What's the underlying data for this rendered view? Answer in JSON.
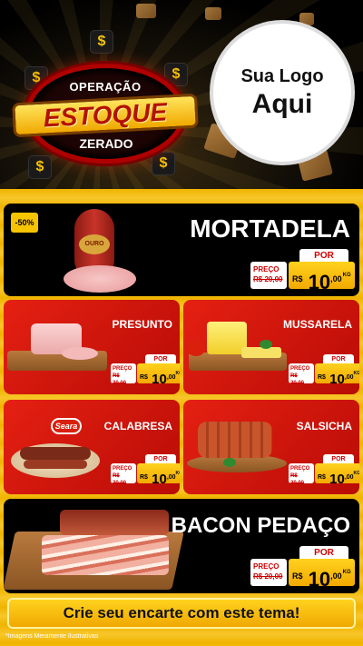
{
  "header": {
    "badge_top": "OPERAÇÃO",
    "badge_main": "ESTOQUE",
    "badge_bottom": "ZERADO",
    "logo_line1": "Sua Logo",
    "logo_line2": "Aqui"
  },
  "colors": {
    "accent_yellow": "#f7c400",
    "card_red": "#d81a0e",
    "card_black": "#000000",
    "price_red": "#d10000"
  },
  "products": {
    "mortadela": {
      "name": "MORTADELA",
      "discount": "-50%",
      "brand_mark": "OURO",
      "por": "POR",
      "preco_label": "PREÇO",
      "old_price": "R$ 20,00",
      "currency": "R$",
      "price_int": "10",
      "price_dec": ",00",
      "unit": "KG"
    },
    "presunto": {
      "name": "PRESUNTO",
      "por": "POR",
      "preco_label": "PREÇO",
      "old_price": "R$ 20,00",
      "currency": "R$",
      "price_int": "10",
      "price_dec": ",00",
      "unit": "KG"
    },
    "mussarela": {
      "name": "MUSSARELA",
      "por": "POR",
      "preco_label": "PREÇO",
      "old_price": "R$ 20,00",
      "currency": "R$",
      "price_int": "10",
      "price_dec": ",00",
      "unit": "KG"
    },
    "calabresa": {
      "name": "CALABRESA",
      "brand_mark": "Seara",
      "por": "POR",
      "preco_label": "PREÇO",
      "old_price": "R$ 20,00",
      "currency": "R$",
      "price_int": "10",
      "price_dec": ",00",
      "unit": "KG"
    },
    "salsicha": {
      "name": "SALSICHA",
      "por": "POR",
      "preco_label": "PREÇO",
      "old_price": "R$ 20,00",
      "currency": "R$",
      "price_int": "10",
      "price_dec": ",00",
      "unit": "KG"
    },
    "bacon": {
      "name": "BACON PEDAÇO",
      "por": "POR",
      "preco_label": "PREÇO",
      "old_price": "R$ 20,00",
      "currency": "R$",
      "price_int": "10",
      "price_dec": ",00",
      "unit": "KG"
    }
  },
  "footer": {
    "cta": "Crie seu encarte com este tema!",
    "disclaimer": "*Imagens Meramente Ilustrativas"
  }
}
